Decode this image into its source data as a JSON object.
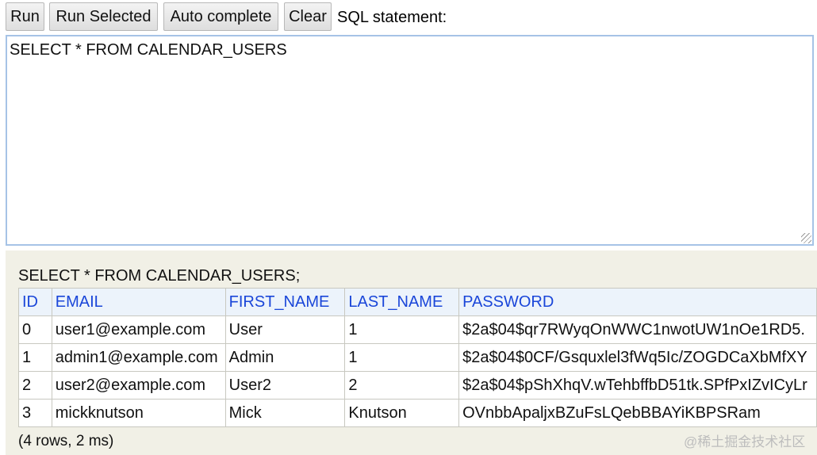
{
  "toolbar": {
    "run_label": "Run",
    "run_selected_label": "Run Selected",
    "autocomplete_label": "Auto complete",
    "clear_label": "Clear",
    "sql_label": "SQL statement:"
  },
  "editor": {
    "value": "SELECT * FROM CALENDAR_USERS"
  },
  "results": {
    "query": "SELECT * FROM CALENDAR_USERS;",
    "columns": [
      "ID",
      "EMAIL",
      "FIRST_NAME",
      "LAST_NAME",
      "PASSWORD"
    ],
    "rows": [
      [
        "0",
        "user1@example.com",
        "User",
        "1",
        "$2a$04$qr7RWyqOnWWC1nwotUW1nOe1RD5."
      ],
      [
        "1",
        "admin1@example.com",
        "Admin",
        "1",
        "$2a$04$0CF/Gsquxlel3fWq5Ic/ZOGDCaXbMfXY"
      ],
      [
        "2",
        "user2@example.com",
        "User2",
        "2",
        "$2a$04$pShXhqV.wTehbffbD51tk.SPfPxIZvICyLr"
      ],
      [
        "3",
        "mickknutson",
        "Mick",
        "Knutson",
        "OVnbbApaljxBZuFsLQebBBAYiKBPSRam"
      ]
    ],
    "summary": "(4 rows, 2 ms)"
  },
  "watermark": "@稀土掘金技术社区",
  "colors": {
    "header_text": "#1a46d9",
    "editor_border": "#a6c3e6",
    "results_background": "#f1f0e6"
  }
}
